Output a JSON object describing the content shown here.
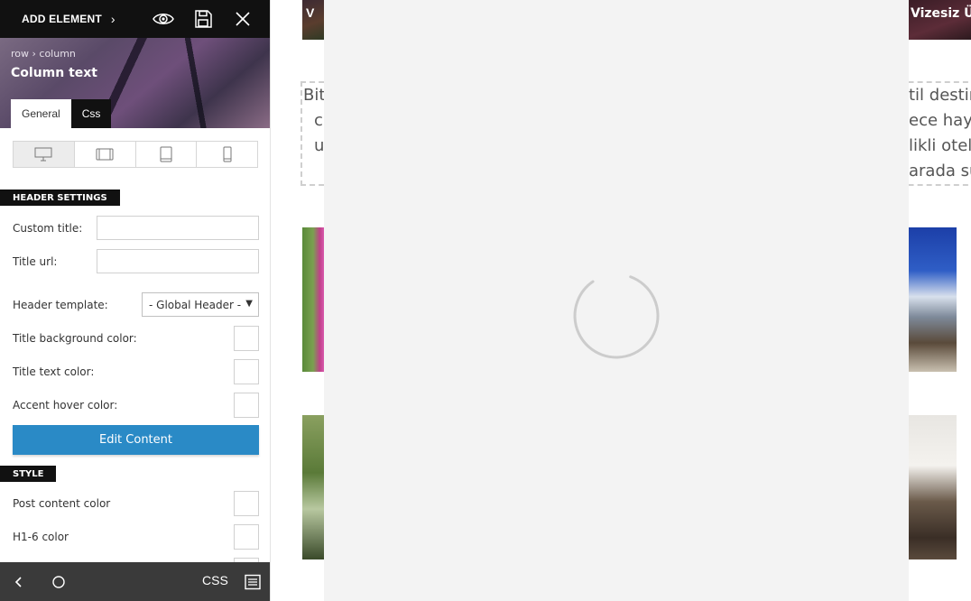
{
  "toolbar": {
    "add_element_label": "ADD ELEMENT",
    "add_element_chevron": "›",
    "icons": [
      "eye-icon",
      "save-icon",
      "close-icon"
    ]
  },
  "panel_header": {
    "breadcrumb": "row › column",
    "element_title": "Column text",
    "tabs": [
      {
        "label": "General",
        "active": true
      },
      {
        "label": "Css",
        "active": false
      }
    ]
  },
  "device_switcher": {
    "devices": [
      "desktop-icon",
      "tablet-landscape-icon",
      "tablet-portrait-icon",
      "mobile-icon"
    ],
    "active": "desktop"
  },
  "header_settings": {
    "section_label": "HEADER SETTINGS",
    "custom_title_label": "Custom title:",
    "custom_title_value": "",
    "title_url_label": "Title url:",
    "title_url_value": "",
    "header_template_label": "Header template:",
    "header_template_value": "- Global Header -",
    "title_bg_color_label": "Title background color:",
    "title_text_color_label": "Title text color:",
    "accent_hover_color_label": "Accent hover color:",
    "edit_content_label": "Edit Content"
  },
  "style": {
    "section_label": "STYLE",
    "post_content_color_label": "Post content color",
    "h16_color_label": "H1-6 color"
  },
  "bottombar": {
    "css_label": "CSS",
    "icons": [
      "back-icon",
      "home-icon",
      "menu-icon"
    ]
  },
  "background_page": {
    "top_left_text": "V",
    "top_right_text": "Vizesiz Ül",
    "left_lines": [
      "Bit",
      "c",
      "u"
    ],
    "right_lines": [
      "til destin",
      "ece hay",
      "likli otel",
      "arada su"
    ]
  },
  "colors": {
    "topbar": "#111111",
    "accent_button": "#2a8ac6",
    "bottombar": "#3a3a3a",
    "overlay": "#f3f3f3",
    "spinner": "#cccccc"
  }
}
